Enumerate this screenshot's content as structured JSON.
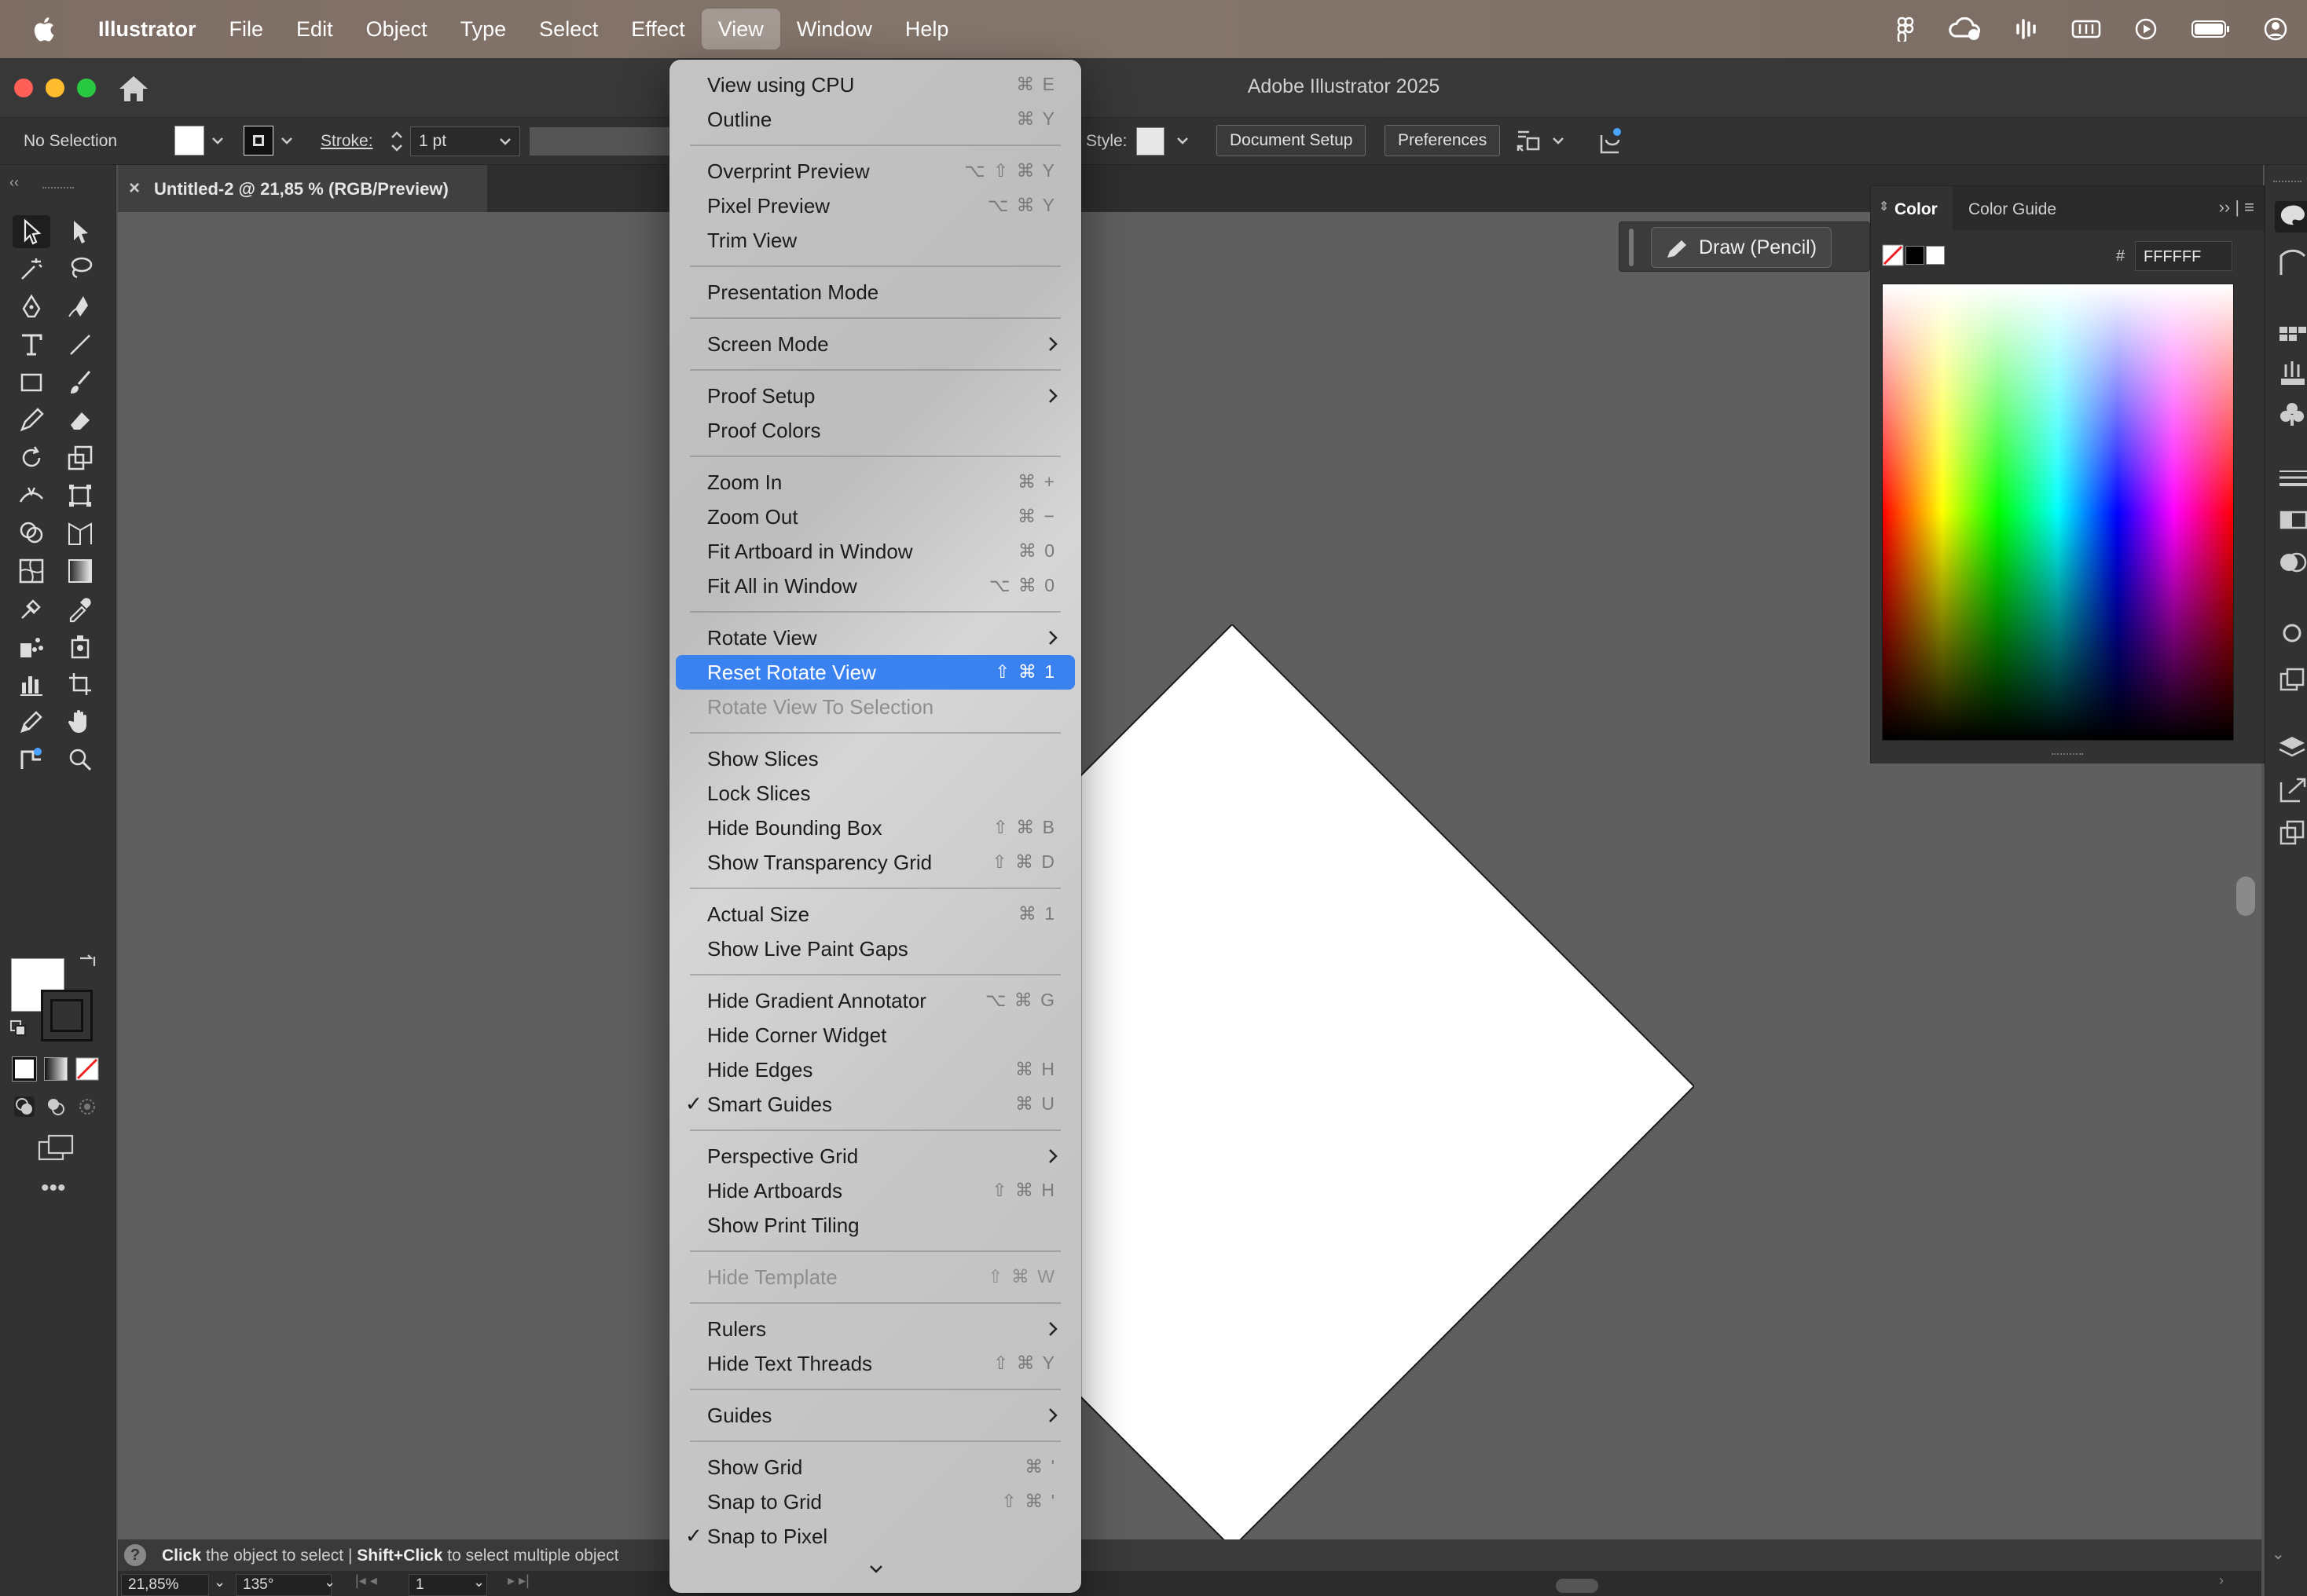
{
  "menubar": {
    "app_name": "Illustrator",
    "items": [
      "File",
      "Edit",
      "Object",
      "Type",
      "Select",
      "Effect",
      "View",
      "Window",
      "Help"
    ],
    "active_item": "View"
  },
  "window": {
    "title": "Adobe Illustrator 2025"
  },
  "controlbar": {
    "selection": "No Selection",
    "stroke_label": "Stroke:",
    "stroke_value": "1 pt",
    "style_label": "Style:",
    "document_setup": "Document Setup",
    "preferences": "Preferences"
  },
  "document_tab": {
    "close": "×",
    "title": "Untitled-2 @ 21,85 % (RGB/Preview)"
  },
  "draw_widget": {
    "label": "Draw (Pencil)"
  },
  "color_panel": {
    "tabs": [
      "Color",
      "Color Guide"
    ],
    "hex_label": "#",
    "hex_value": "FFFFFF",
    "controls": "›› | ≡"
  },
  "status": {
    "help": "?",
    "part1_bold": "Click",
    "part1": " the object to select  |  ",
    "part2_bold": "Shift+Click",
    "part2": " to select multiple object"
  },
  "bottombar": {
    "zoom": "21,85%",
    "rotation": "135°",
    "artboard": "1"
  },
  "view_menu": {
    "items": [
      {
        "label": "View using CPU",
        "shortcut": "⌘ E"
      },
      {
        "label": "Outline",
        "shortcut": "⌘ Y"
      },
      {
        "label": "Overprint Preview",
        "shortcut": "⌥ ⇧ ⌘ Y"
      },
      {
        "label": "Pixel Preview",
        "shortcut": "⌥ ⌘ Y"
      },
      {
        "label": "Trim View",
        "shortcut": ""
      },
      {
        "label": "Presentation Mode",
        "shortcut": ""
      },
      {
        "label": "Screen Mode",
        "shortcut": ""
      },
      {
        "label": "Proof Setup",
        "shortcut": ""
      },
      {
        "label": "Proof Colors",
        "shortcut": ""
      },
      {
        "label": "Zoom In",
        "shortcut": "⌘ +"
      },
      {
        "label": "Zoom Out",
        "shortcut": "⌘ −"
      },
      {
        "label": "Fit Artboard in Window",
        "shortcut": "⌘ 0"
      },
      {
        "label": "Fit All in Window",
        "shortcut": "⌥ ⌘ 0"
      },
      {
        "label": "Rotate View",
        "shortcut": ""
      },
      {
        "label": "Reset Rotate View",
        "shortcut": "⇧ ⌘ 1"
      },
      {
        "label": "Rotate View To Selection",
        "shortcut": ""
      },
      {
        "label": "Show Slices",
        "shortcut": ""
      },
      {
        "label": "Lock Slices",
        "shortcut": ""
      },
      {
        "label": "Hide Bounding Box",
        "shortcut": "⇧ ⌘ B"
      },
      {
        "label": "Show Transparency Grid",
        "shortcut": "⇧ ⌘ D"
      },
      {
        "label": "Actual Size",
        "shortcut": "⌘ 1"
      },
      {
        "label": "Show Live Paint Gaps",
        "shortcut": ""
      },
      {
        "label": "Hide Gradient Annotator",
        "shortcut": "⌥ ⌘ G"
      },
      {
        "label": "Hide Corner Widget",
        "shortcut": ""
      },
      {
        "label": "Hide Edges",
        "shortcut": "⌘ H"
      },
      {
        "label": "Smart Guides",
        "shortcut": "⌘ U",
        "check": "✓"
      },
      {
        "label": "Perspective Grid",
        "shortcut": ""
      },
      {
        "label": "Hide Artboards",
        "shortcut": "⇧ ⌘ H"
      },
      {
        "label": "Show Print Tiling",
        "shortcut": ""
      },
      {
        "label": "Hide Template",
        "shortcut": "⇧ ⌘ W"
      },
      {
        "label": "Rulers",
        "shortcut": ""
      },
      {
        "label": "Hide Text Threads",
        "shortcut": "⇧ ⌘ Y"
      },
      {
        "label": "Guides",
        "shortcut": ""
      },
      {
        "label": "Show Grid",
        "shortcut": "⌘ '"
      },
      {
        "label": "Snap to Grid",
        "shortcut": "⇧ ⌘ '"
      },
      {
        "label": "Snap to Pixel",
        "shortcut": "",
        "check": "✓"
      }
    ]
  }
}
